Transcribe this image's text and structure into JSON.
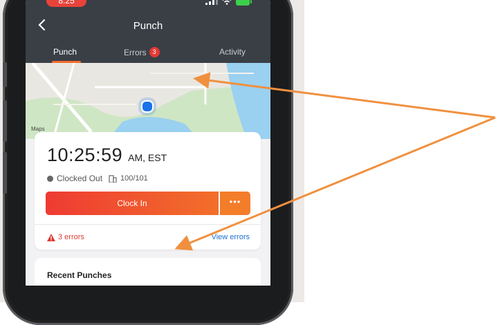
{
  "status_bar": {
    "time": "8:25"
  },
  "header": {
    "title": "Punch",
    "back_icon": "chevron-left-icon"
  },
  "tabs": [
    {
      "label": "Punch",
      "active": true
    },
    {
      "label": "Errors",
      "badge": "3",
      "active": false
    },
    {
      "label": "Activity",
      "active": false
    }
  ],
  "map": {
    "legal_label": "Maps"
  },
  "punch_card": {
    "time": "10:25:59",
    "time_suffix": "AM, EST",
    "status": "Clocked Out",
    "location": "100/101",
    "clock_in_label": "Clock In",
    "more_label": "•••",
    "errors_label": "3 errors",
    "view_errors_label": "View errors"
  },
  "recent": {
    "title": "Recent Punches"
  },
  "colors": {
    "header_bg": "#3a3f46",
    "accent_orange": "#f26b2b",
    "clock_in_red": "#ee3b33",
    "error_red": "#d93b35",
    "link_blue": "#1d6fd6",
    "annotation_arrow": "#f0903f"
  }
}
